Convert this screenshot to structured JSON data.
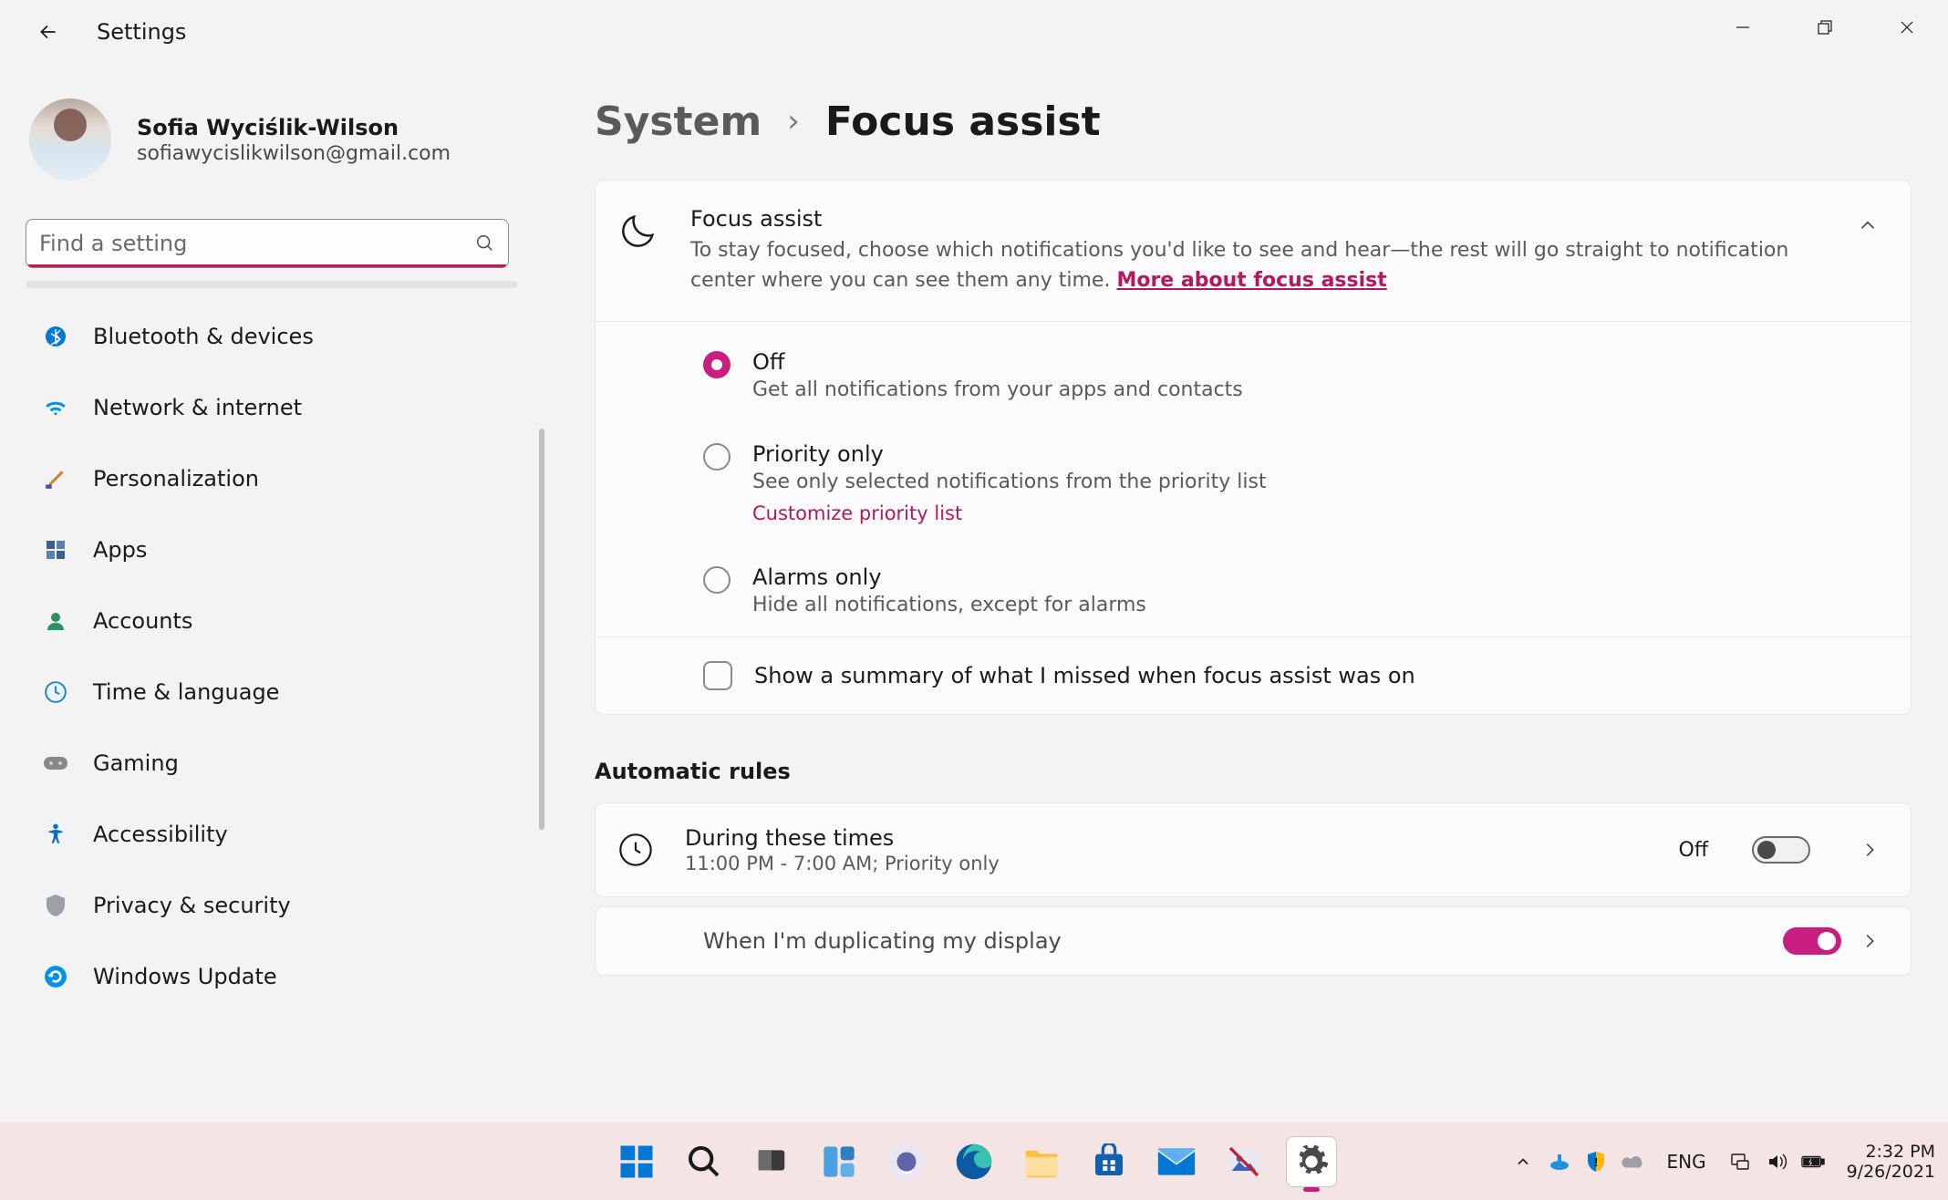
{
  "app_title": "Settings",
  "window_controls": {
    "minimize": "Minimize",
    "maximize": "Restore",
    "close": "Close"
  },
  "profile": {
    "name": "Sofia Wyciślik-Wilson",
    "email": "sofiawycislikwilson@gmail.com"
  },
  "search": {
    "placeholder": "Find a setting"
  },
  "sidebar": {
    "items": [
      {
        "icon": "bluetooth",
        "label": "Bluetooth & devices"
      },
      {
        "icon": "wifi",
        "label": "Network & internet"
      },
      {
        "icon": "brush",
        "label": "Personalization"
      },
      {
        "icon": "apps",
        "label": "Apps"
      },
      {
        "icon": "person",
        "label": "Accounts"
      },
      {
        "icon": "globe",
        "label": "Time & language"
      },
      {
        "icon": "gamepad",
        "label": "Gaming"
      },
      {
        "icon": "accessibility",
        "label": "Accessibility"
      },
      {
        "icon": "shield",
        "label": "Privacy & security"
      },
      {
        "icon": "update",
        "label": "Windows Update"
      }
    ]
  },
  "breadcrumb": {
    "parent": "System",
    "current": "Focus assist"
  },
  "focus": {
    "title": "Focus assist",
    "desc": "To stay focused, choose which notifications you'd like to see and hear—the rest will go straight to notification center where you can see them any time.  ",
    "link": "More about focus assist",
    "radios": [
      {
        "title": "Off",
        "desc": "Get all notifications from your apps and contacts",
        "selected": true
      },
      {
        "title": "Priority only",
        "desc": "See only selected notifications from the priority list",
        "selected": false,
        "link": "Customize priority list"
      },
      {
        "title": "Alarms only",
        "desc": "Hide all notifications, except for alarms",
        "selected": false
      }
    ],
    "summary_checkbox": "Show a summary of what I missed when focus assist was on"
  },
  "rules": {
    "heading": "Automatic rules",
    "items": [
      {
        "title": "During these times",
        "desc": "11:00 PM - 7:00 AM; Priority only",
        "state": "Off",
        "on": false
      },
      {
        "title": "When I'm duplicating my display",
        "desc": "",
        "state": "On",
        "on": true
      }
    ]
  },
  "taskbar": {
    "lang": "ENG",
    "time": "2:32 PM",
    "date": "9/26/2021"
  }
}
